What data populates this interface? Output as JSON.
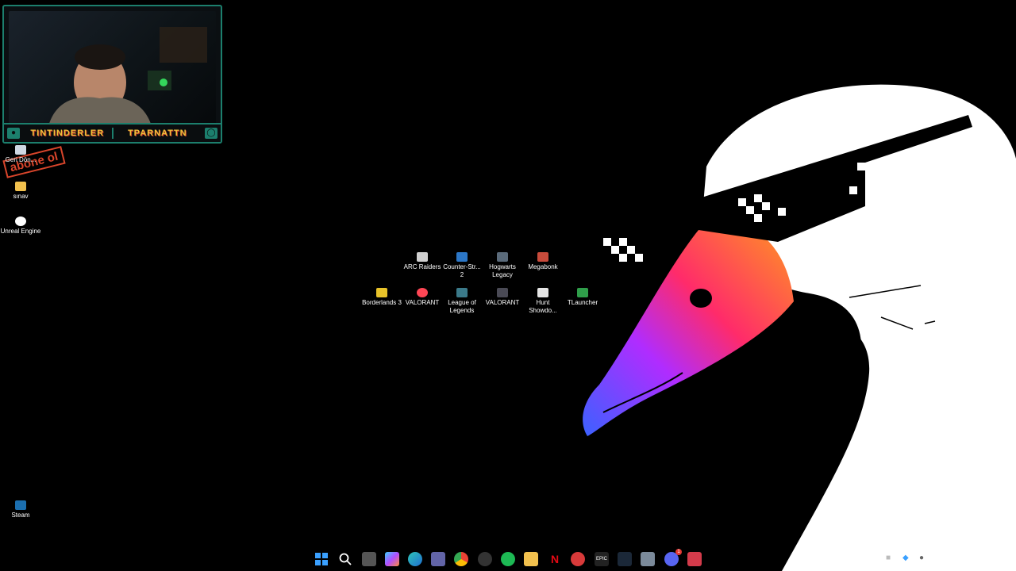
{
  "overlay": {
    "handle_left": "TINTINDERLER",
    "handle_right": "TPARNATTN",
    "stamp": "abone ol"
  },
  "desktop_left": [
    {
      "name": "recycle-bin",
      "label": "Geri Dön..."
    },
    {
      "name": "sinav",
      "label": "sınav"
    },
    {
      "name": "unreal-engine",
      "label": "Unreal Engine"
    },
    {
      "name": "steam",
      "label": "Steam"
    }
  ],
  "desktop_grid": [
    {
      "label": "ARC Raiders"
    },
    {
      "label": "Counter-Str... 2"
    },
    {
      "label": "Hogwarts Legacy"
    },
    {
      "label": "Megabonk"
    },
    {
      "label": "Borderlands 3"
    },
    {
      "label": "VALORANT"
    },
    {
      "label": "League of Legends"
    },
    {
      "label": "VALORANT"
    },
    {
      "label": "Hunt Showdo..."
    },
    {
      "label": "TLauncher"
    }
  ],
  "taskbar": {
    "icons": [
      "windows-start-icon",
      "search-icon",
      "task-view-icon",
      "copilot-icon",
      "edge-icon",
      "teams-icon",
      "chrome-icon",
      "obs-icon",
      "spotify-icon",
      "file-explorer-icon",
      "netflix-icon",
      "app-red-icon",
      "epic-games-icon",
      "steam-icon",
      "settings-icon",
      "discord-icon",
      "valorant-icon"
    ],
    "discord_badge": "1"
  },
  "tray": {
    "icons": [
      "network-icon",
      "bluetooth-icon",
      "microphone-icon"
    ]
  },
  "colors": {
    "accent": "#1c7f6d",
    "stamp": "#d9452b"
  }
}
